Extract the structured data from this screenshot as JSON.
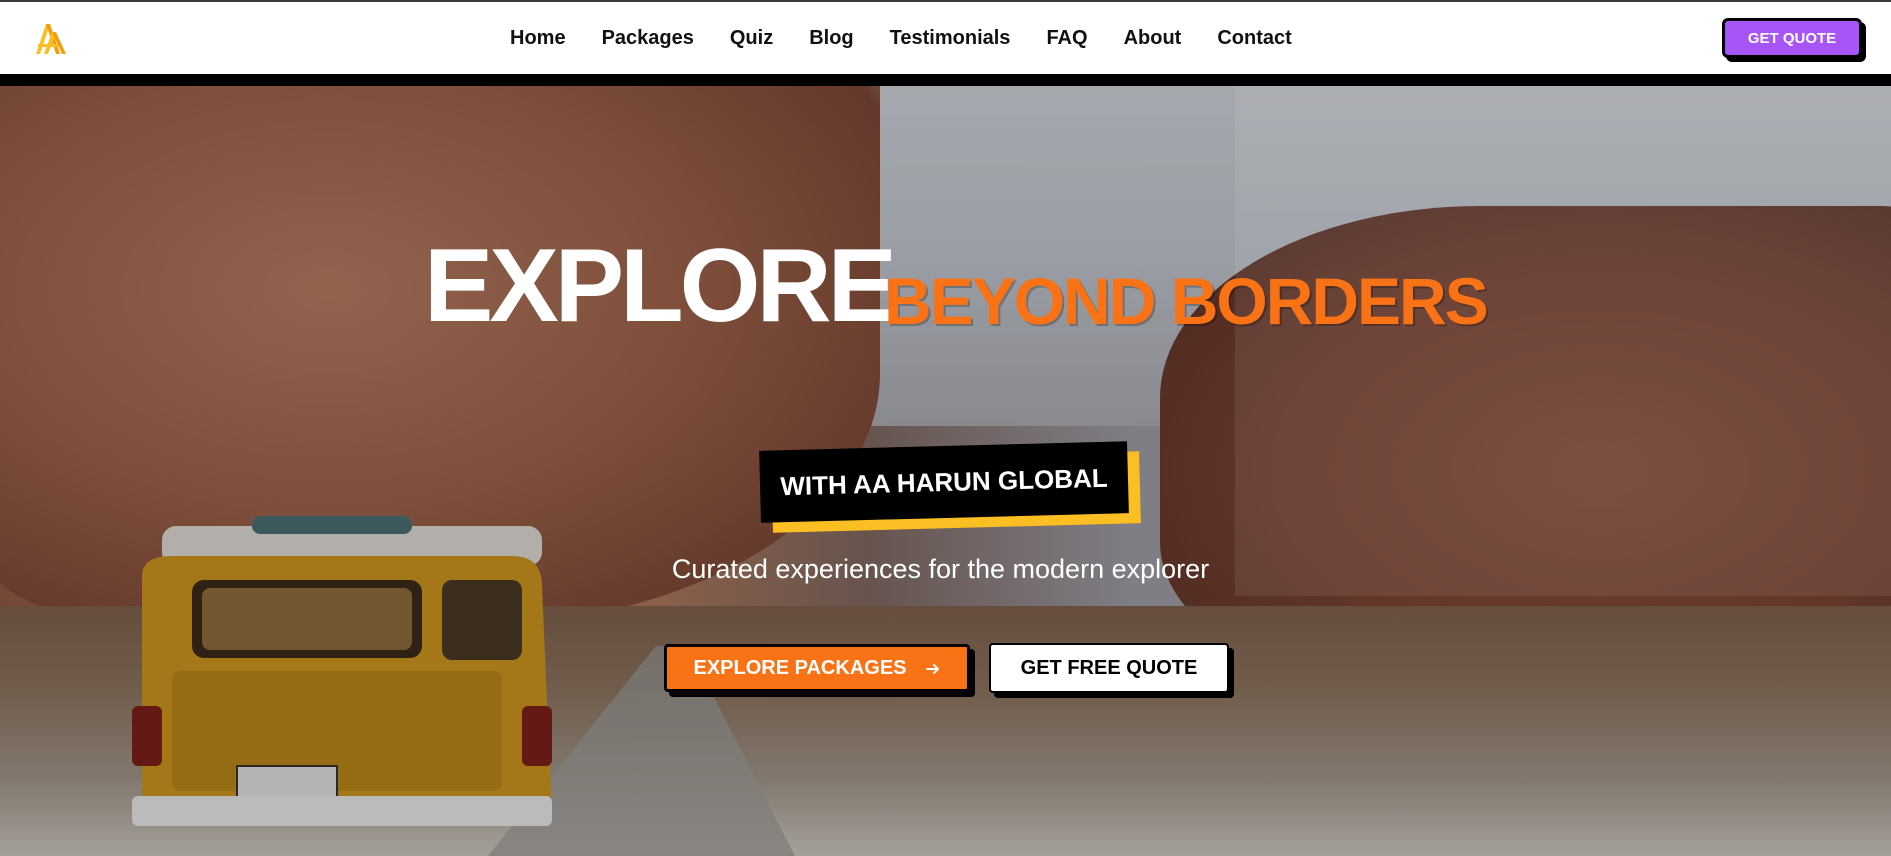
{
  "brand": {
    "logo_icon": "aa-monogram-logo-icon",
    "accent": "#fbbf24"
  },
  "nav": {
    "items": [
      {
        "label": "Home"
      },
      {
        "label": "Packages"
      },
      {
        "label": "Quiz"
      },
      {
        "label": "Blog"
      },
      {
        "label": "Testimonials"
      },
      {
        "label": "FAQ"
      },
      {
        "label": "About"
      },
      {
        "label": "Contact"
      }
    ],
    "cta_label": "GET QUOTE",
    "cta_color": "#a855f7"
  },
  "hero": {
    "title_main": "EXPLORE",
    "title_accent": "BEYOND BORDERS",
    "title_accent_color": "#f97316",
    "tagline": "WITH AA HARUN GLOBAL",
    "subtitle": "Curated experiences for the modern explorer",
    "primary_button": {
      "label": "EXPLORE PACKAGES",
      "icon": "arrow-right-icon",
      "color": "#f97316"
    },
    "secondary_button": {
      "label": "GET FREE QUOTE"
    }
  }
}
